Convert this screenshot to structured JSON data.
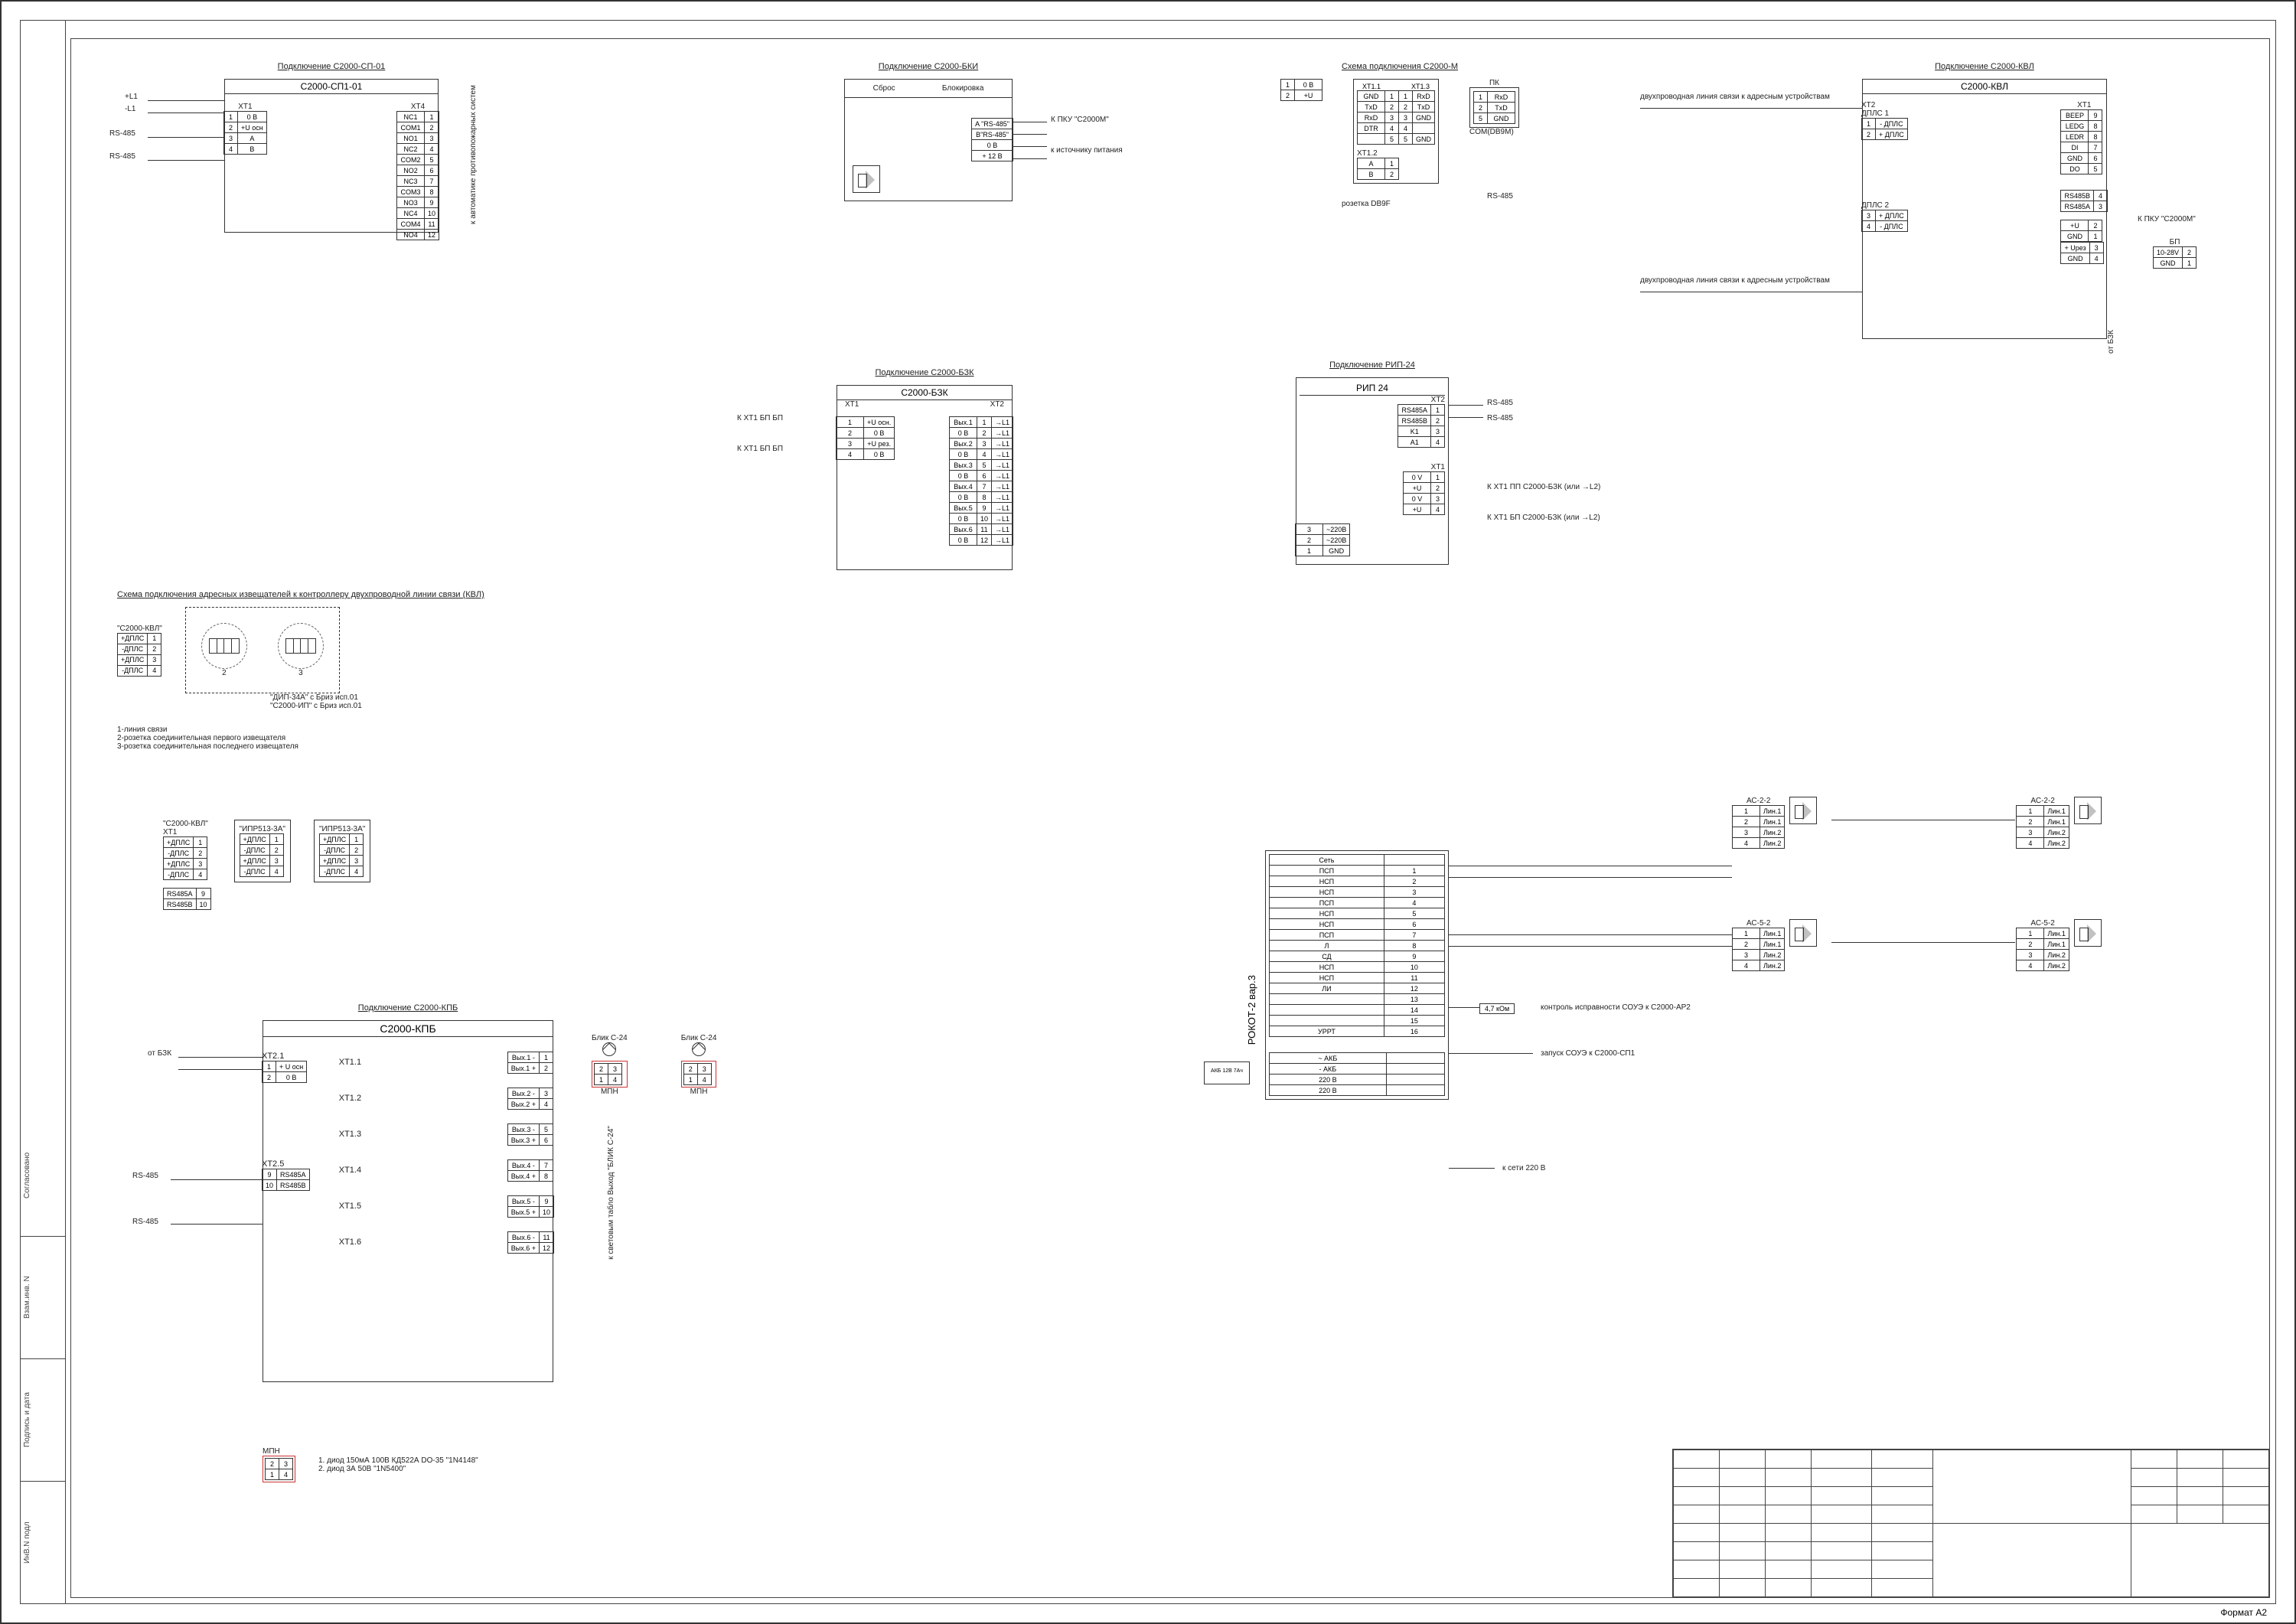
{
  "titlecol": [
    "ИнВ.N подл",
    "Подпись и дата",
    "Взам.инв. N",
    "Согласовано"
  ],
  "format": "Формат  A2",
  "s2000sp101": {
    "heading": "Подключение С2000-СП-01",
    "name": "С2000-СП1-01",
    "left_conn": "XT1",
    "right_conn": "XT4",
    "left_pins": [
      [
        "1",
        "0 В"
      ],
      [
        "2",
        "+U осн"
      ],
      [
        "3",
        "A"
      ],
      [
        "4",
        "B"
      ]
    ],
    "left_labels": [
      "+L1",
      "-L1",
      "RS-485",
      "RS-485"
    ],
    "right_pins": [
      [
        "NC1",
        "1"
      ],
      [
        "COM1",
        "2"
      ],
      [
        "NO1",
        "3"
      ],
      [
        "NC2",
        "4"
      ],
      [
        "COM2",
        "5"
      ],
      [
        "NO2",
        "6"
      ],
      [
        "NC3",
        "7"
      ],
      [
        "COM3",
        "8"
      ],
      [
        "NO3",
        "9"
      ],
      [
        "NC4",
        "10"
      ],
      [
        "COM4",
        "11"
      ],
      [
        "NO4",
        "12"
      ]
    ],
    "right_note": "к автоматике противопожарных систем"
  },
  "bki": {
    "heading": "Подключение С2000-БКИ",
    "top_labels": [
      "Сброс",
      "Блокировка"
    ],
    "pins": [
      [
        "A \"RS-485\""
      ],
      [
        "B\"RS-485\""
      ],
      [
        "0 В"
      ],
      [
        "+ 12 В"
      ]
    ],
    "notes": [
      "К ПКУ \"С2000М\"",
      "к источнику питания"
    ]
  },
  "s2000m": {
    "heading": "Схема подключения С2000-М",
    "xt11": "XT1.1",
    "xt13": "XT1.3",
    "xt12": "XT1.2",
    "pk": "ПК",
    "left": [
      [
        "1",
        "0 В"
      ],
      [
        "2",
        "+U"
      ]
    ],
    "mid_rows": [
      [
        "GND",
        "1",
        "1",
        "RxD"
      ],
      [
        "TxD",
        "2",
        "2",
        "TxD"
      ],
      [
        "RxD",
        "3",
        "3",
        "GND"
      ],
      [
        "DTR",
        "4",
        "4",
        ""
      ],
      [
        "",
        "5",
        "5",
        "GND"
      ]
    ],
    "below": [
      [
        "A",
        "1"
      ],
      [
        "B",
        "2"
      ]
    ],
    "rs485": "RS-485",
    "socket1": "розетка DB9F",
    "socket2": "COM(DB9M)"
  },
  "kdl": {
    "heading": "Подключение С2000-КВЛ",
    "name": "С2000-КВЛ",
    "xt2": "XT2",
    "dplc1": "ДПЛС 1",
    "dplc2": "ДПЛС 2",
    "p1": [
      [
        "1",
        "- ДПЛС"
      ],
      [
        "2",
        "+ ДПЛС"
      ]
    ],
    "p2": [
      [
        "3",
        "+ ДПЛС"
      ],
      [
        "4",
        "- ДПЛС"
      ]
    ],
    "xt1": "XT1",
    "xt1rows": [
      [
        "BEEP",
        "9"
      ],
      [
        "LEDG",
        "8"
      ],
      [
        "LEDR",
        "8"
      ],
      [
        "DI",
        "7"
      ],
      [
        "GND",
        "6"
      ],
      [
        "DO",
        "5"
      ]
    ],
    "rsrows": [
      [
        "RS485B",
        "4"
      ],
      [
        "RS485A",
        "3"
      ]
    ],
    "rsnote": "К ПКУ \"С2000М\"",
    "bp": "БП",
    "bprows": [
      [
        "+U",
        "2",
        "10-28V",
        "2"
      ],
      [
        "GND",
        "1",
        "GND",
        "1"
      ]
    ],
    "pwr_rows": [
      [
        "+ Uрез",
        "3"
      ],
      [
        "GND",
        "4"
      ]
    ],
    "from_bzk": "от БЗК",
    "line_note": "двухпроводная линия связи к адресным устройствам"
  },
  "bzk": {
    "heading": "Подключение С2000-БЗК",
    "name": "С2000-БЗК",
    "xt1": "XT1",
    "xt2": "XT2",
    "left": [
      [
        "1",
        "+U осн."
      ],
      [
        "2",
        "0 В"
      ],
      [
        "3",
        "+U рез."
      ],
      [
        "4",
        "0 В"
      ]
    ],
    "left_labels": [
      "К XT1 БП БП",
      "К XT1 БП БП"
    ],
    "right": [
      [
        "Вых.1",
        "1",
        "→L1"
      ],
      [
        "0 В",
        "2",
        "→L1"
      ],
      [
        "Вых.2",
        "3",
        "→L1"
      ],
      [
        "0 В",
        "4",
        "→L1"
      ],
      [
        "Вых.3",
        "5",
        "→L1"
      ],
      [
        "0 В",
        "6",
        "→L1"
      ],
      [
        "Вых.4",
        "7",
        "→L1"
      ],
      [
        "0 В",
        "8",
        "→L1"
      ],
      [
        "Вых.5",
        "9",
        "→L1"
      ],
      [
        "0 В",
        "10",
        "→L1"
      ],
      [
        "Вых.6",
        "11",
        "→L1"
      ],
      [
        "0 В",
        "12",
        "→L1"
      ]
    ]
  },
  "rip24": {
    "heading": "Подключение РИП-24",
    "name": "РИП 24",
    "xt2": "XT2",
    "xt2rows": [
      [
        "RS485A",
        "1"
      ],
      [
        "RS485B",
        "2"
      ],
      [
        "K1",
        "3"
      ],
      [
        "A1",
        "4"
      ]
    ],
    "rs485": "RS-485",
    "xt1": "XT1",
    "xt1rows": [
      [
        "0 V",
        "1"
      ],
      [
        "+U",
        "2"
      ],
      [
        "0 V",
        "3"
      ],
      [
        "+U",
        "4"
      ]
    ],
    "xt1notes": [
      "К XT1 ПП С2000-БЗК (или →L2)",
      "К XT1 БП С2000-БЗК (или →L2)"
    ],
    "pwrconn": [
      [
        "3",
        "~220В"
      ],
      [
        "2",
        "~220В"
      ],
      [
        "1",
        "GND"
      ]
    ]
  },
  "detectors": {
    "heading": "Схема подключения адресных извещателей к контроллеру двухпроводной линии связи (КВЛ)",
    "device": "\"С2000-КВЛ\"",
    "det_labels": [
      "2",
      "3"
    ],
    "det_models": [
      "\"ДИП-34А\" с Бриз исп.01",
      "\"С2000-ИП\" с Бриз исп.01"
    ],
    "legend": [
      "1-линия связи",
      "2-розетка соединительная первого извещателя",
      "3-розетка соединительная последнего извещателя"
    ]
  },
  "ipr": {
    "device": "\"С2000-КВЛ\"",
    "xt1": "XT1",
    "mods": [
      "\"ИПР513-3А\"",
      "\"ИПР513-3А\""
    ],
    "rows": [
      [
        "+ДПЛС",
        "1"
      ],
      [
        "-ДПЛС",
        "2"
      ],
      [
        "+ДПЛС",
        "3"
      ],
      [
        "-ДПЛС",
        "4"
      ]
    ],
    "sub_rows": [
      [
        "RS485A",
        "9"
      ],
      [
        "RS485B",
        "10"
      ]
    ]
  },
  "kpb": {
    "heading": "Подключение С2000-КПБ",
    "name": "С2000-КПБ",
    "xt21": "XT2.1",
    "xt21rows": [
      [
        "1",
        "+ U осн"
      ],
      [
        "2",
        "0 В"
      ]
    ],
    "xt25": "XT2.5",
    "xt25rows": [
      [
        "9",
        "RS485A"
      ],
      [
        "10",
        "RS485B"
      ]
    ],
    "rs485": "RS-485",
    "from_bzk": "от БЗК",
    "groups": [
      {
        "hdr": "XT1.1",
        "rows": [
          [
            "Вых.1 -",
            "1"
          ],
          [
            "Вых.1 +",
            "2"
          ]
        ]
      },
      {
        "hdr": "XT1.2",
        "rows": [
          [
            "Вых.2 -",
            "3"
          ],
          [
            "Вых.2 +",
            "4"
          ]
        ]
      },
      {
        "hdr": "XT1.3",
        "rows": [
          [
            "Вых.3 -",
            "5"
          ],
          [
            "Вых.3 +",
            "6"
          ]
        ]
      },
      {
        "hdr": "XT1.4",
        "rows": [
          [
            "Вых.4 -",
            "7"
          ],
          [
            "Вых.4 +",
            "8"
          ]
        ]
      },
      {
        "hdr": "XT1.5",
        "rows": [
          [
            "Вых.5 -",
            "9"
          ],
          [
            "Вых.5 +",
            "10"
          ]
        ]
      },
      {
        "hdr": "XT1.6",
        "rows": [
          [
            "Вых.6 -",
            "11"
          ],
          [
            "Вых.6 +",
            "12"
          ]
        ]
      }
    ],
    "blik": "Блик С-24",
    "mpn": "МПН",
    "right_note": "к световым табло Выход \"БЛИК С-24\"",
    "mpn_notes": [
      "1. диод 150мА 100В КД522А DO-35 \"1N4148\"",
      "2. диод 3А 50В \"1N5400\""
    ]
  },
  "rokot": {
    "name": "РОКОТ-2 вар.3",
    "pins": [
      [
        "Сеть",
        ""
      ],
      [
        "ПСП",
        "1"
      ],
      [
        "НСП",
        "2"
      ],
      [
        "НСП",
        "3"
      ],
      [
        "ПСП",
        "4"
      ],
      [
        "НСП",
        "5"
      ],
      [
        "НСП",
        "6"
      ],
      [
        "ПСП",
        "7"
      ],
      [
        "Л",
        "8"
      ],
      [
        "СД",
        "9"
      ],
      [
        "НСП",
        "10"
      ],
      [
        "НСП",
        "11"
      ],
      [
        "ЛИ",
        "12"
      ],
      [
        "",
        "13"
      ],
      [
        "",
        "14"
      ],
      [
        "",
        "15"
      ],
      [
        "УРРТ",
        "16"
      ]
    ],
    "res": "4,7 кОм",
    "note1": "контроль исправности СОУЭ к С2000-АР2",
    "note2": "запуск СОУЭ к С2000-СП1",
    "pwr_rows": [
      [
        "~ АКБ",
        ""
      ],
      [
        "- АКБ",
        ""
      ],
      [
        "220 В",
        ""
      ],
      [
        "220 В",
        ""
      ]
    ],
    "pwr_note": "к сети 220 В",
    "akb": "АКБ 12В 7Ач",
    "ac_name": [
      "АС-2-2",
      "АС-2-2",
      "АС-5-2",
      "АС-5-2"
    ],
    "ac_rows": [
      [
        "1",
        "Лин.1"
      ],
      [
        "2",
        "Лин.1"
      ],
      [
        "3",
        "Лин.2"
      ],
      [
        "4",
        "Лин.2"
      ]
    ]
  }
}
